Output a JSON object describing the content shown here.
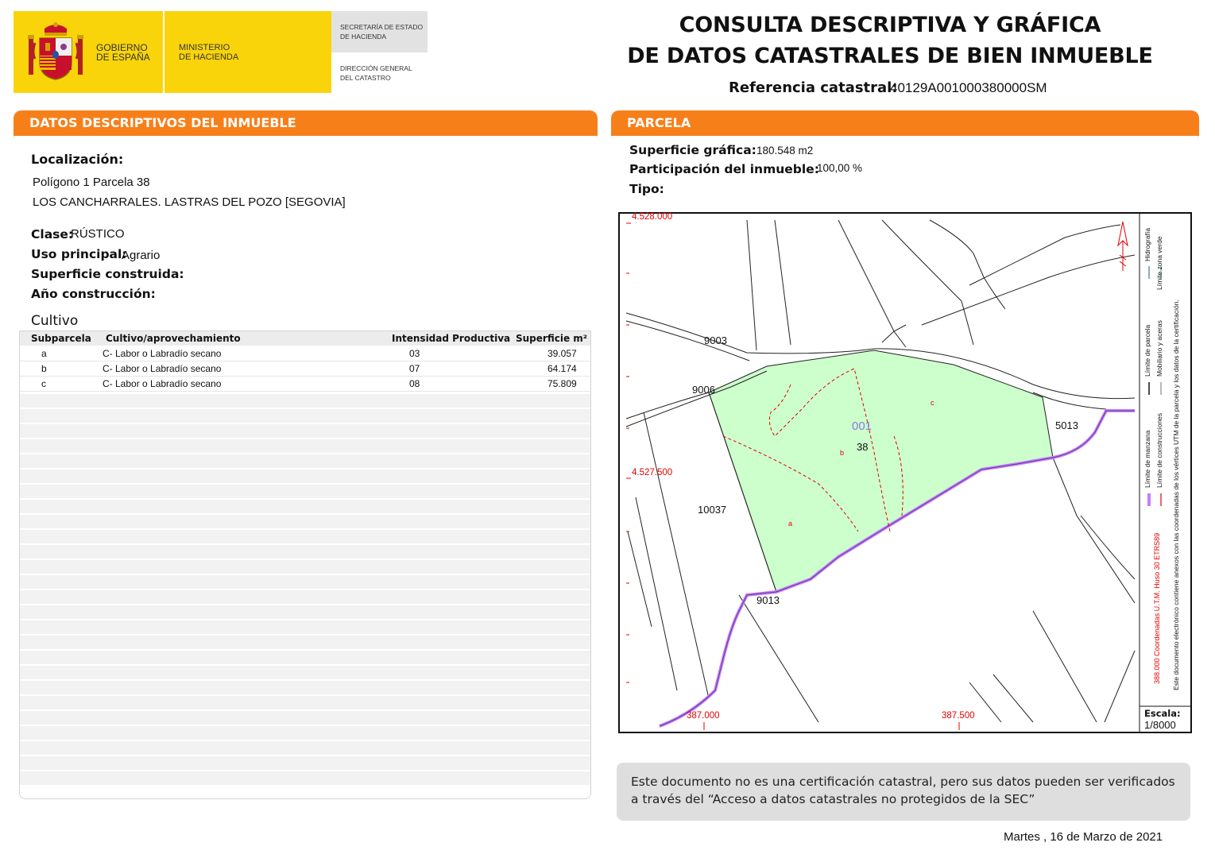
{
  "header": {
    "gobierno": [
      "GOBIERNO",
      "DE ESPAÑA"
    ],
    "ministerio": [
      "MINISTERIO",
      "DE HACIENDA"
    ],
    "secretaria": [
      "SECRETARÍA DE ESTADO",
      "DE HACIENDA"
    ],
    "direccion": [
      "DIRECCIÓN GENERAL",
      "DEL CATASTRO"
    ],
    "title_line1": "CONSULTA DESCRIPTIVA Y GRÁFICA",
    "title_line2": "DE DATOS CATASTRALES DE BIEN INMUEBLE",
    "ref_label": "Referencia catastral:",
    "ref_value": "40129A001000380000SM"
  },
  "descriptivos": {
    "section_title": "DATOS DESCRIPTIVOS DEL INMUEBLE",
    "localizacion_label": "Localización:",
    "localizacion_line1": "Polígono 1 Parcela 38",
    "localizacion_line2": "LOS CANCHARRALES. LASTRAS DEL POZO [SEGOVIA]",
    "clase_label": "Clase:",
    "clase_value": "RÚSTICO",
    "uso_label": "Uso principal:",
    "uso_value": "Agrario",
    "superficie_label": "Superficie construida:",
    "anio_label": "Año construcción:"
  },
  "cultivo": {
    "title": "Cultivo",
    "headers": [
      "Subparcela",
      "Cultivo/aprovechamiento",
      "Intensidad Productiva",
      "Superficie m²"
    ],
    "rows": [
      [
        "a",
        "C- Labor o Labradío secano",
        "03",
        "39.057"
      ],
      [
        "b",
        "C- Labor o Labradío secano",
        "07",
        "64.174"
      ],
      [
        "c",
        "C- Labor o Labradío secano",
        "08",
        "75.809"
      ]
    ]
  },
  "parcela": {
    "section_title": "PARCELA",
    "superficie_label": "Superficie gráfica:",
    "superficie_value": "180.548 m2",
    "participacion_label": "Participación del inmueble:",
    "participacion_value": "100,00 %",
    "tipo_label": "Tipo:"
  },
  "map": {
    "coord_top": "4.528.000",
    "coord_mid": "4.527.500",
    "coord_x1": "387.000",
    "coord_x2": "387.500",
    "labels": [
      "9003",
      "9006",
      "001",
      "38",
      "5013",
      "10037",
      "9013"
    ],
    "subparcelas": [
      "a",
      "b",
      "c"
    ],
    "legend": {
      "manzana": "Límite de manzana",
      "construcciones": "Límite de construcciones",
      "parcela": "Límite de parcela",
      "mobiliario": "Mobiliario y aceras",
      "hidrografia": "Hidrografía",
      "zona_verde": "Límite zona verde",
      "coordenadas": "388.000 Coordenadas U.T.M. Huso 30 ETRS89",
      "documento": "Este documento electrónico contiene anexos con las coordenadas de los vértices UTM de la parcela y los datos de la certificación."
    },
    "escala_label": "Escala:",
    "escala_value": "1/8000"
  },
  "note": "Este documento no es una certificación catastral, pero sus datos pueden ser verificados a través del “Acceso a datos catastrales no protegidos de la SEC”",
  "date": "Martes , 16 de Marzo de 2021",
  "colors": {
    "orange": "#f77f1a",
    "yellow": "#f9d40a",
    "parcel_fill": "#ccffcc",
    "road_purple": "#c77dff",
    "coord_red": "#e60000"
  }
}
